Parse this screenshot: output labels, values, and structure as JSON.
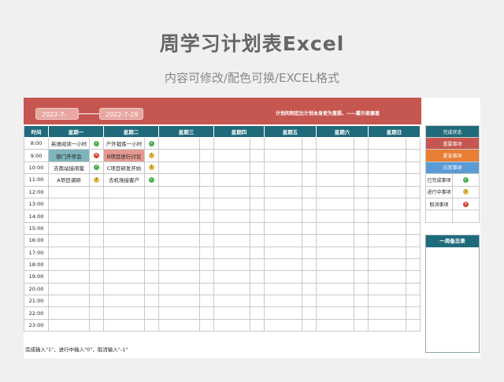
{
  "page": {
    "title": "周学习计划表Excel",
    "subtitle": "内容可修改/配色可换/EXCEL格式"
  },
  "banner": {
    "date_start": "2022-7-",
    "date_end": "2022-7-29",
    "quote": "计划的制定比计划本身更为重要。——戴尔麦康基"
  },
  "grid": {
    "headers": [
      "时间",
      "星期一",
      "星期二",
      "星期三",
      "星期四",
      "星期五",
      "星期六",
      "星期日"
    ],
    "times": [
      "8:00",
      "9:00",
      "10:00",
      "11:00",
      "12:00",
      "13:00",
      "14:00",
      "15:00",
      "16:00",
      "17:00",
      "18:00",
      "19:00",
      "20:00",
      "21:00",
      "22:00",
      "23:00"
    ],
    "monday": [
      {
        "task": "英语阅读一小时",
        "status": "done"
      },
      {
        "task": "部门开早会",
        "status": "cancel"
      },
      {
        "task": "去南站接闺蜜",
        "status": "done"
      },
      {
        "task": "A项目调研",
        "status": "prog"
      }
    ],
    "tuesday": [
      {
        "task": "户外锻炼一小时",
        "status": "done"
      },
      {
        "task": "B项目进行讨论",
        "status": "prog"
      },
      {
        "task": "C项目研发开始",
        "status": "prog"
      },
      {
        "task": "去机场接客户",
        "status": "done"
      }
    ]
  },
  "legend": {
    "header": "完成状态",
    "important": "重要事项",
    "urgent": "紧急事项",
    "routine": "日常事项",
    "done_label": "已完成事项",
    "prog_label": "进行中事项",
    "cancel_label": "取消事项"
  },
  "memo": {
    "header": "一周备忘录"
  },
  "footnote": "完成输入\"1\"，进行中输入\"0\"，取消输入\"-1\"",
  "icons": {
    "done": "check-icon",
    "prog": "exclamation-icon",
    "cancel": "cross-icon"
  },
  "colors": {
    "banner": "#c65750",
    "header": "#1f6b7b",
    "urgent": "#e87d34",
    "routine": "#5b9bd5"
  }
}
